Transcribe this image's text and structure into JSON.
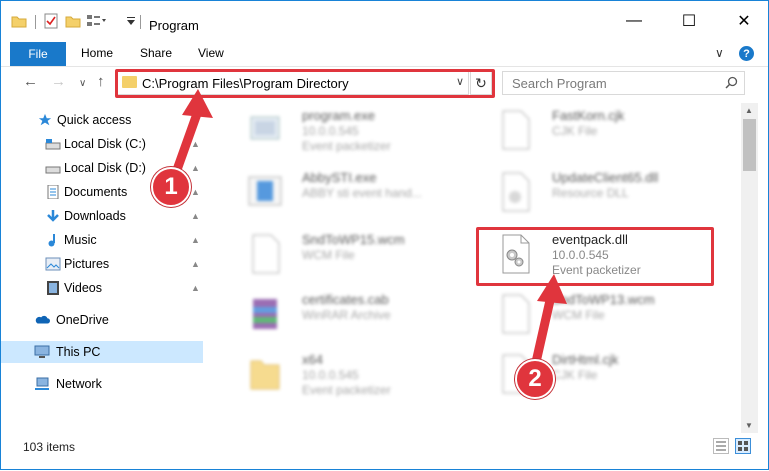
{
  "window": {
    "title": "Program",
    "controls": {
      "minimize": "—",
      "maximize": "☐",
      "close": "✕"
    }
  },
  "ribbon": {
    "tabs": [
      {
        "label": "File"
      },
      {
        "label": "Home"
      },
      {
        "label": "Share"
      },
      {
        "label": "View"
      }
    ],
    "help": "?",
    "collapse": "∨"
  },
  "navigation": {
    "back": "←",
    "forward": "→",
    "recent": "∨",
    "up": "↑"
  },
  "address": {
    "path": "C:\\Program Files\\Program Directory",
    "dropdown": "∨",
    "refresh": "↻"
  },
  "search": {
    "placeholder": "Search Program"
  },
  "sidebar": {
    "items": [
      {
        "label": "Quick access",
        "icon": "star-icon",
        "pinned": false
      },
      {
        "label": "Local Disk (C:)",
        "icon": "drive-icon",
        "pinned": true
      },
      {
        "label": "Local Disk (D:)",
        "icon": "drive-icon",
        "pinned": true
      },
      {
        "label": "Documents",
        "icon": "documents-icon",
        "pinned": true
      },
      {
        "label": "Downloads",
        "icon": "downloads-icon",
        "pinned": true
      },
      {
        "label": "Music",
        "icon": "music-icon",
        "pinned": true
      },
      {
        "label": "Pictures",
        "icon": "pictures-icon",
        "pinned": true
      },
      {
        "label": "Videos",
        "icon": "videos-icon",
        "pinned": true
      },
      {
        "label": "OneDrive",
        "icon": "cloud-icon",
        "pinned": false
      },
      {
        "label": "This PC",
        "icon": "computer-icon",
        "pinned": false,
        "selected": true
      },
      {
        "label": "Network",
        "icon": "network-icon",
        "pinned": false
      }
    ],
    "pin_glyph": "📌"
  },
  "files": [
    {
      "name": "program.exe",
      "line2": "10.0.0.545",
      "line3": "Event packetizer",
      "icon": "exe-icon",
      "blurred": true
    },
    {
      "name": "FastKorn.cjk",
      "line2": "CJK File",
      "line3": "",
      "icon": "blank-file-icon",
      "blurred": true
    },
    {
      "name": "AbbySTI.exe",
      "line2": "ABBY sti event hand...",
      "line3": "",
      "icon": "window-app-icon",
      "blurred": true
    },
    {
      "name": "UpdateClient65.dll",
      "line2": "Resource DLL",
      "line3": "",
      "icon": "dll-icon",
      "blurred": true
    },
    {
      "name": "SndToWP15.wcm",
      "line2": "WCM File",
      "line3": "",
      "icon": "blank-file-icon",
      "blurred": true
    },
    {
      "name": "eventpack.dll",
      "line2": "10.0.0.545",
      "line3": "Event packetizer",
      "icon": "dll-gear-icon",
      "blurred": false
    },
    {
      "name": "certificates.cab",
      "line2": "WinRAR Archive",
      "line3": "",
      "icon": "archive-icon",
      "blurred": true
    },
    {
      "name": "SndToWP13.wcm",
      "line2": "WCM File",
      "line3": "",
      "icon": "blank-file-icon",
      "blurred": true
    },
    {
      "name": "x64",
      "line2": "10.0.0.545",
      "line3": "Event packetizer",
      "icon": "folder-icon",
      "blurred": true
    },
    {
      "name": "DirtHtml.cjk",
      "line2": "CJK File",
      "line3": "",
      "icon": "blank-file-icon",
      "blurred": true
    }
  ],
  "status": {
    "item_count": "103 items"
  },
  "annotations": {
    "step1": "1",
    "step2": "2"
  },
  "colors": {
    "accent": "#1979ca",
    "annotation": "#e0353d",
    "selection": "#cce8ff"
  }
}
